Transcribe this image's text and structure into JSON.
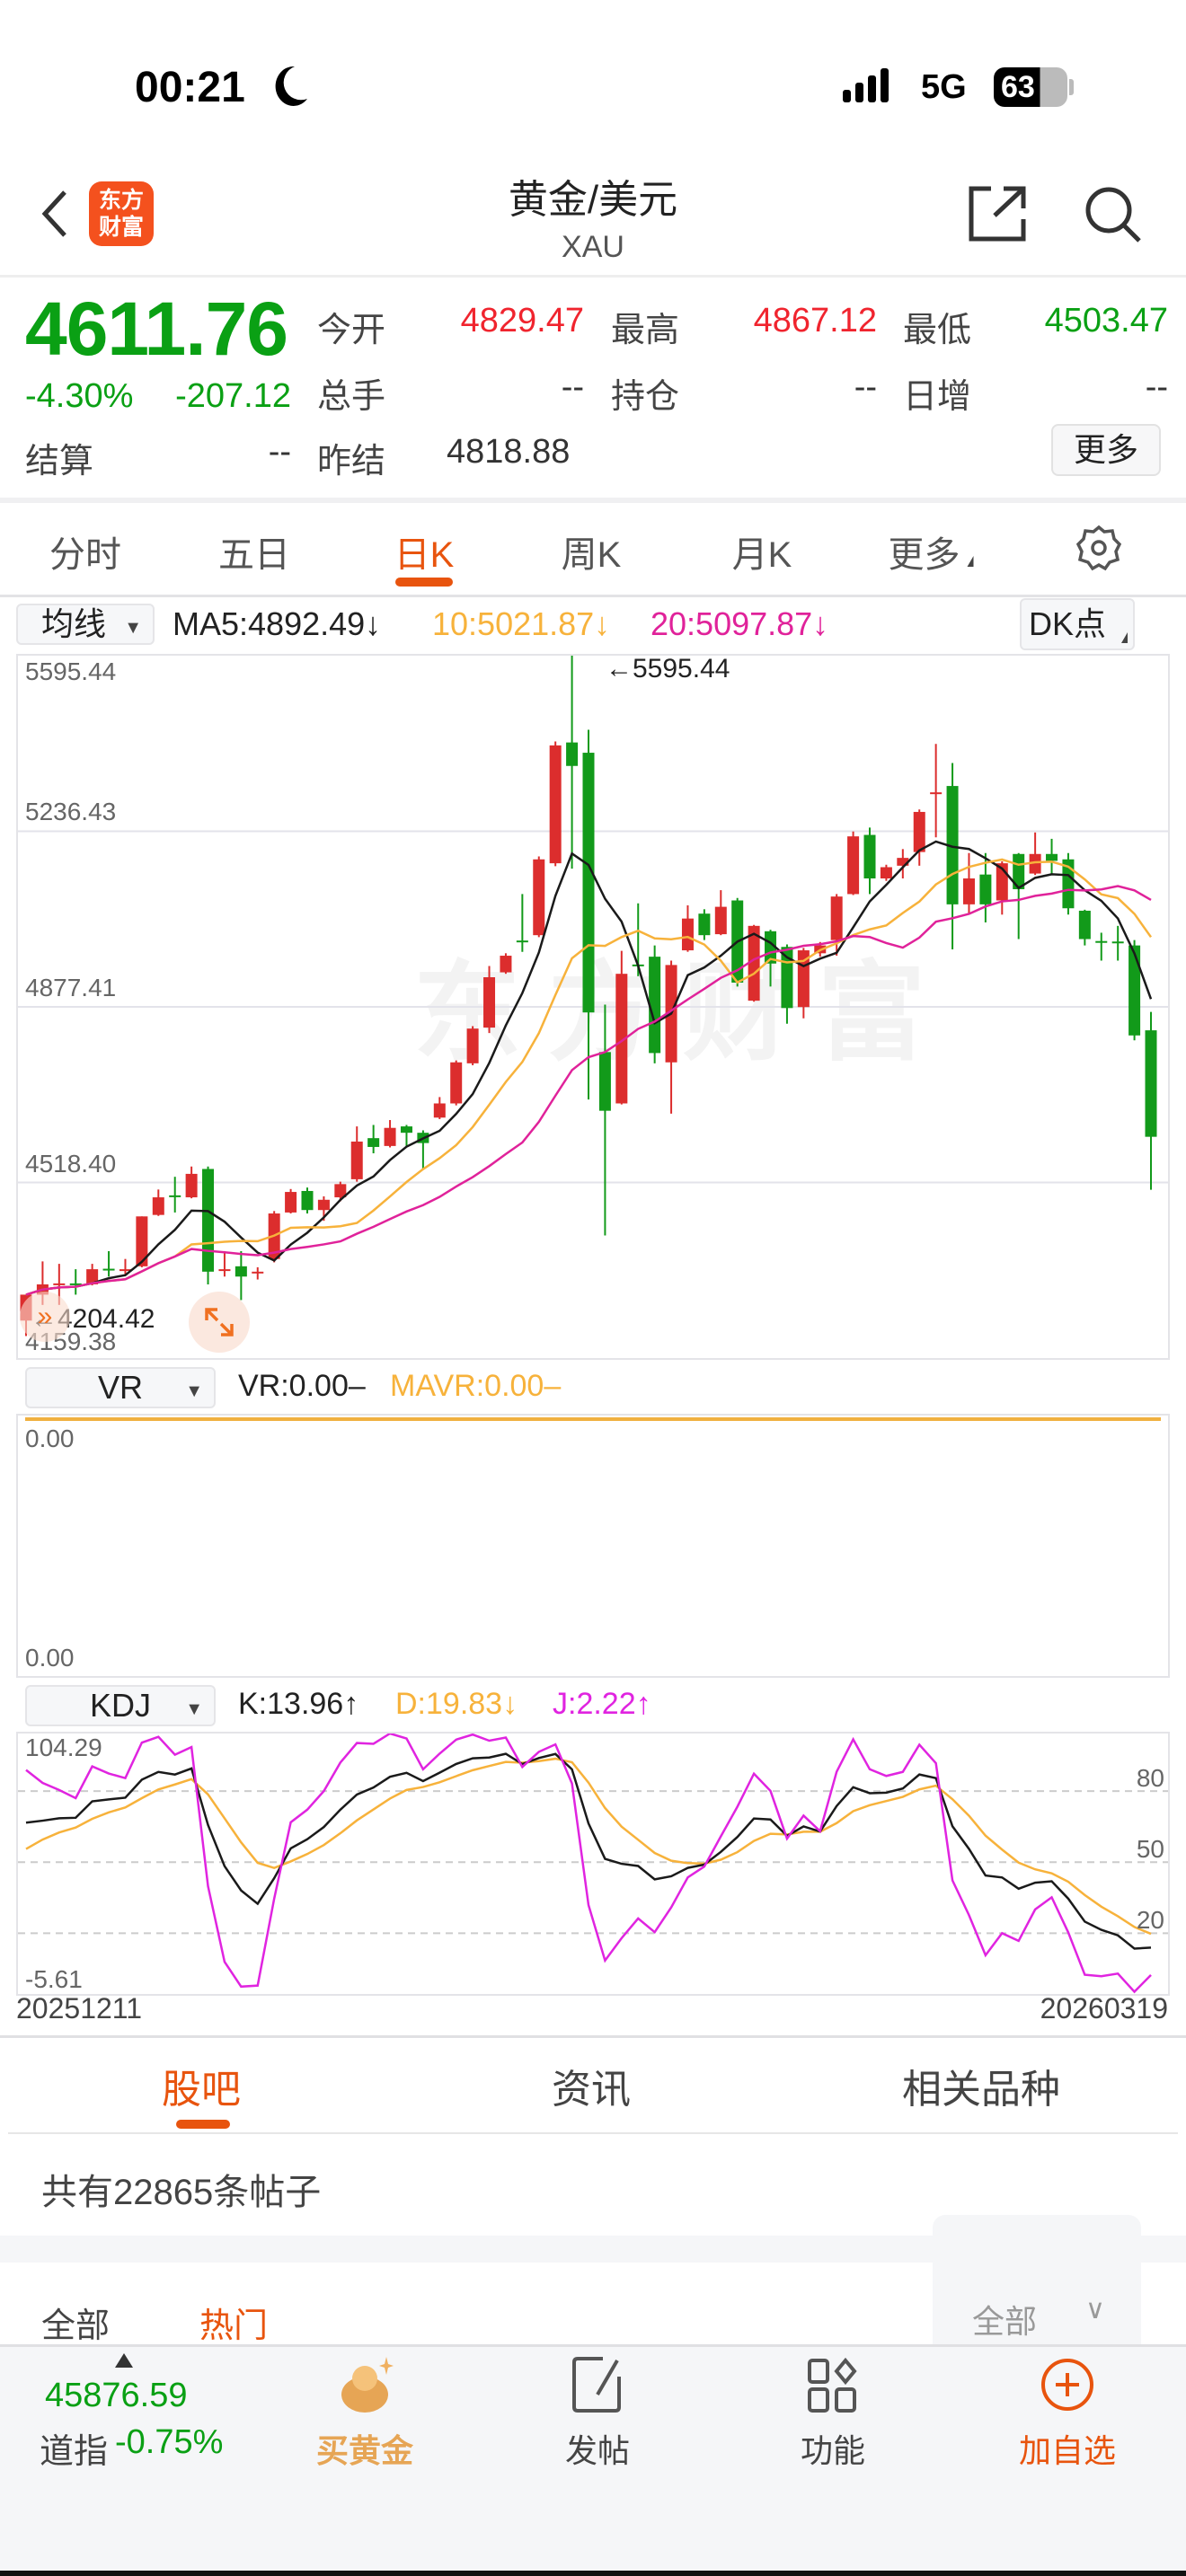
{
  "status_bar": {
    "time": "00:21",
    "network": "5G",
    "battery": "63"
  },
  "header": {
    "logo_text": "东方财富",
    "title": "黄金/美元",
    "subtitle": "XAU"
  },
  "quote": {
    "price": "4611.76",
    "change_pct": "-4.30%",
    "change": "-207.12",
    "fields": [
      {
        "label": "今开",
        "value": "4829.47"
      },
      {
        "label": "最高",
        "value": "4867.12"
      },
      {
        "label": "最低",
        "value": "4503.47"
      },
      {
        "label": "总手",
        "value": "--"
      },
      {
        "label": "持仓",
        "value": "--"
      },
      {
        "label": "日增",
        "value": "--"
      },
      {
        "label": "结算",
        "value": "--"
      },
      {
        "label": "昨结",
        "value": "4818.88"
      }
    ],
    "more_button": "更多"
  },
  "period_tabs": [
    "分时",
    "五日",
    "日K",
    "周K",
    "月K",
    "更多"
  ],
  "active_period": "日K",
  "ma_legend": {
    "selector": "均线",
    "ma5": "MA5:4892.49↓",
    "ma10": "10:5021.87↓",
    "ma20": "20:5097.87↓",
    "dk_button": "DK点"
  },
  "colors": {
    "up": "#dc2d2d",
    "down": "#129a1a",
    "ma5": "#1a1a1a",
    "ma10": "#f7b23b",
    "ma20": "#e0229a",
    "k": "#1a1a1a",
    "d": "#f7b23b",
    "j": "#e024e0",
    "accent": "#e8540e"
  },
  "chart_data": [
    {
      "type": "candlestick",
      "title": "黄金/美元 日K",
      "ylim": [
        4159.38,
        5595.44
      ],
      "y_ticks": [
        "5595.44",
        "5236.43",
        "4877.41",
        "4518.40",
        "4159.38"
      ],
      "max_label": "←5595.44",
      "min_label": "←4204.42",
      "x_range": [
        "20251211",
        "20260319"
      ],
      "series_order": "open,high,low,close",
      "candles": [
        [
          4236,
          4289,
          4204.42,
          4289
        ],
        [
          4289,
          4357,
          4268,
          4310
        ],
        [
          4310,
          4352,
          4268,
          4312
        ],
        [
          4312,
          4341,
          4289,
          4310
        ],
        [
          4310,
          4352,
          4308,
          4341
        ],
        [
          4342,
          4378,
          4326,
          4340
        ],
        [
          4339,
          4362,
          4331,
          4341
        ],
        [
          4347,
          4449,
          4345,
          4449
        ],
        [
          4452,
          4504,
          4450,
          4488
        ],
        [
          4492,
          4530,
          4457,
          4490
        ],
        [
          4488,
          4551,
          4486,
          4536
        ],
        [
          4546,
          4551,
          4310,
          4336
        ],
        [
          4339,
          4378,
          4326,
          4341
        ],
        [
          4347,
          4378,
          4278,
          4326
        ],
        [
          4334,
          4345,
          4320,
          4336
        ],
        [
          4362,
          4460,
          4355,
          4455
        ],
        [
          4457,
          4505,
          4455,
          4499
        ],
        [
          4501,
          4508,
          4455,
          4462
        ],
        [
          4462,
          4490,
          4440,
          4483
        ],
        [
          4488,
          4520,
          4480,
          4515
        ],
        [
          4525,
          4633,
          4520,
          4602
        ],
        [
          4609,
          4636,
          4578,
          4591
        ],
        [
          4593,
          4646,
          4590,
          4630
        ],
        [
          4633,
          4636,
          4593,
          4620
        ],
        [
          4620,
          4625,
          4546,
          4599
        ],
        [
          4651,
          4693,
          4648,
          4680
        ],
        [
          4680,
          4768,
          4676,
          4764
        ],
        [
          4762,
          4838,
          4758,
          4833
        ],
        [
          4835,
          4961,
          4824,
          4938
        ],
        [
          4948,
          4987,
          4945,
          4982
        ],
        [
          5013,
          5108,
          4990,
          5011
        ],
        [
          5024,
          5185,
          5020,
          5179
        ],
        [
          5171,
          5420,
          5165,
          5412
        ],
        [
          5418,
          5595.44,
          5160,
          5370
        ],
        [
          5397,
          5444,
          4688,
          4866
        ],
        [
          4785,
          4882,
          4410,
          4665
        ],
        [
          4680,
          4992,
          4678,
          4945
        ],
        [
          4964,
          5089,
          4940,
          4962
        ],
        [
          4980,
          5003,
          4762,
          4783
        ],
        [
          4764,
          4972,
          4659,
          4963
        ],
        [
          4993,
          5085,
          4990,
          5058
        ],
        [
          5068,
          5077,
          5014,
          5024
        ],
        [
          5026,
          5116,
          5024,
          5082
        ],
        [
          5095,
          5100,
          4919,
          4927
        ],
        [
          4890,
          5045,
          4888,
          5043
        ],
        [
          5032,
          5035,
          4919,
          4966
        ],
        [
          5000,
          5005,
          4843,
          4875
        ],
        [
          4877,
          4998,
          4854,
          4993
        ],
        [
          4987,
          5010,
          4980,
          5003
        ],
        [
          5014,
          5108,
          4982,
          5103
        ],
        [
          5108,
          5236,
          5106,
          5226
        ],
        [
          5229,
          5244,
          5108,
          5140
        ],
        [
          5140,
          5168,
          5135,
          5163
        ],
        [
          5166,
          5200,
          5140,
          5182
        ],
        [
          5194,
          5281,
          5166,
          5276
        ],
        [
          5314,
          5415,
          5224,
          5316
        ],
        [
          5329,
          5376,
          4995,
          5087
        ],
        [
          5087,
          5192,
          5066,
          5140
        ],
        [
          5148,
          5192,
          5050,
          5087
        ],
        [
          5095,
          5175,
          5066,
          5171
        ],
        [
          5190,
          5192,
          5016,
          5118
        ],
        [
          5150,
          5234,
          5147,
          5190
        ],
        [
          5190,
          5221,
          5150,
          5176
        ],
        [
          5179,
          5192,
          5066,
          5079
        ],
        [
          5074,
          5076,
          5003,
          5016
        ],
        [
          5012,
          5029,
          4972,
          5010
        ],
        [
          5011,
          5043,
          4972,
          5010
        ],
        [
          5003,
          5014,
          4809,
          4819
        ],
        [
          4829.47,
          4867.12,
          4503.47,
          4611.76
        ]
      ],
      "ma_periods": [
        5,
        10,
        20
      ]
    },
    {
      "type": "line",
      "title": "VR",
      "selector": "VR",
      "vr_label": "VR:0.00–",
      "mavr_label": "MAVR:0.00–",
      "y_ticks": [
        "0.00",
        "0.00"
      ],
      "value": 0
    },
    {
      "type": "line",
      "title": "KDJ",
      "selector": "KDJ",
      "k_label": "K:13.96↑",
      "d_label": "D:19.83↓",
      "j_label": "J:2.22↑",
      "ylim": [
        -5.61,
        104.29
      ],
      "y_ticks": [
        "104.29",
        "-5.61"
      ],
      "ref_lines": [
        "80",
        "50",
        "20"
      ],
      "params": [
        9,
        3,
        3
      ]
    }
  ],
  "dates": {
    "start": "20251211",
    "end": "20260319"
  },
  "bottom_tabs": [
    "股吧",
    "资讯",
    "相关品种"
  ],
  "post_count": "共有22865条帖子",
  "filters": {
    "all": "全部",
    "hot": "热门",
    "dropdown": "全部"
  },
  "bottom_nav": {
    "index_value": "45876.59",
    "index_name": "道指",
    "index_change": "-0.75%",
    "buy_gold": "买黄金",
    "post": "发帖",
    "functions": "功能",
    "add_watch": "加自选"
  }
}
